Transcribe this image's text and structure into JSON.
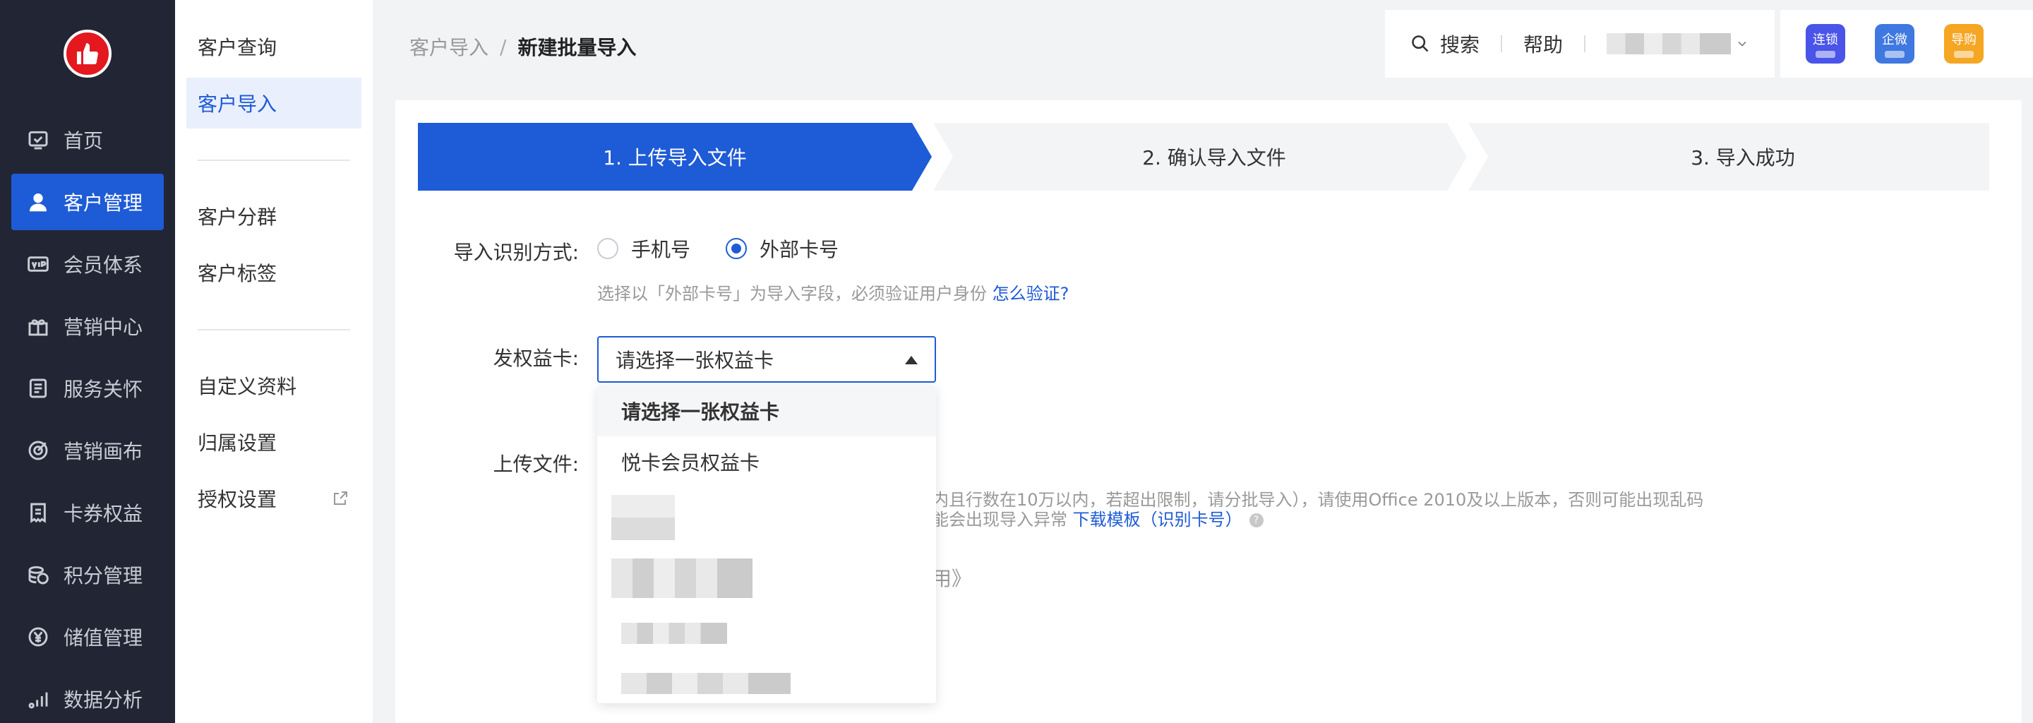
{
  "nav": {
    "items": [
      {
        "label": "首页",
        "icon": "home-icon"
      },
      {
        "label": "客户管理",
        "icon": "user-icon",
        "active": true
      },
      {
        "label": "会员体系",
        "icon": "vip-icon"
      },
      {
        "label": "营销中心",
        "icon": "gift-icon"
      },
      {
        "label": "服务关怀",
        "icon": "service-icon"
      },
      {
        "label": "营销画布",
        "icon": "target-icon"
      },
      {
        "label": "卡券权益",
        "icon": "coupon-icon"
      },
      {
        "label": "积分管理",
        "icon": "points-icon"
      },
      {
        "label": "储值管理",
        "icon": "yuan-icon"
      },
      {
        "label": "数据分析",
        "icon": "chart-icon"
      }
    ]
  },
  "subnav": {
    "group1": [
      "客户查询",
      "客户导入"
    ],
    "group2": [
      "客户分群",
      "客户标签"
    ],
    "group3": [
      "自定义资料",
      "归属设置",
      "授权设置"
    ]
  },
  "breadcrumb": {
    "parent": "客户导入",
    "sep": "/",
    "current": "新建批量导入"
  },
  "topbar": {
    "search": "搜索",
    "help": "帮助"
  },
  "apps": [
    {
      "label": "连锁",
      "color": "#4a54e8"
    },
    {
      "label": "企微",
      "color": "#3f78e0"
    },
    {
      "label": "导购",
      "color": "#f5a623"
    }
  ],
  "steps": [
    "1. 上传导入文件",
    "2. 确认导入文件",
    "3. 导入成功"
  ],
  "form": {
    "identify_label": "导入识别方式:",
    "radio_phone": "手机号",
    "radio_card": "外部卡号",
    "hint_text": "选择以「外部卡号」为导入字段，必须验证用户身份 ",
    "hint_link": "怎么验证?",
    "card_label": "发权益卡:",
    "select_value": "请选择一张权益卡",
    "upload_label": "上传文件:",
    "upload_desc1": "内且行数在10万以内，若超出限制，请分批导入），请使用Office 2010及以上版本，否则可能出现乱码",
    "upload_desc2": "能会出现导入异常 ",
    "template_link": "下载模板（识别卡号）",
    "help_icon": "?",
    "instruction_link": "用》"
  },
  "dropdown": {
    "options": [
      "请选择一张权益卡",
      "悦卡会员权益卡"
    ]
  }
}
